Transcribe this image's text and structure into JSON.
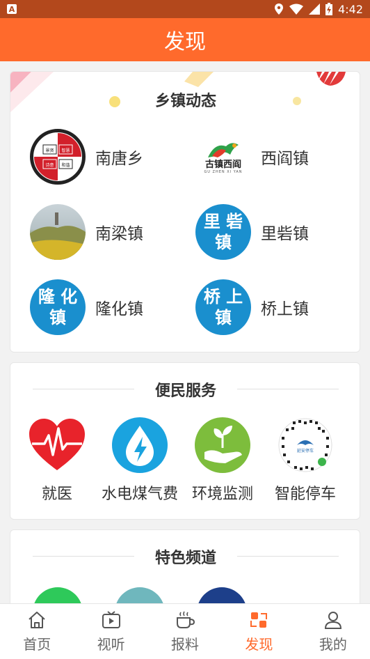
{
  "status_bar": {
    "time": "4:42",
    "notification_icon": "A"
  },
  "header": {
    "title": "发现"
  },
  "towns": {
    "title": "乡镇动态",
    "items": [
      {
        "label": "南唐乡",
        "logo_text": [
          "景贤",
          "智慧",
          "诗意",
          "和谐"
        ]
      },
      {
        "label": "西阎镇",
        "logo_text": "古镇西阎",
        "logo_subtext": "GU ZHEN XI YAN"
      },
      {
        "label": "南梁镇"
      },
      {
        "label": "里砦镇",
        "logo_text": [
          "里 砦",
          "镇"
        ]
      },
      {
        "label": "隆化镇",
        "logo_text": [
          "隆 化",
          "镇"
        ]
      },
      {
        "label": "桥上镇",
        "logo_text": [
          "桥 上",
          "镇"
        ]
      }
    ]
  },
  "services": {
    "title": "便民服务",
    "items": [
      {
        "label": "就医",
        "icon": "heart-pulse-icon",
        "color": "#e8232b"
      },
      {
        "label": "水电煤气费",
        "icon": "water-drop-bolt-icon",
        "color": "#1aa3df"
      },
      {
        "label": "环境监测",
        "icon": "hand-sprout-icon",
        "color": "#7dbd3c"
      },
      {
        "label": "智能停车",
        "icon": "qr-code-icon",
        "qr_caption": "延安停车"
      }
    ]
  },
  "channels": {
    "title": "特色频道"
  },
  "tabbar": {
    "items": [
      {
        "label": "首页",
        "icon": "home-icon"
      },
      {
        "label": "视听",
        "icon": "tv-play-icon"
      },
      {
        "label": "报料",
        "icon": "coffee-cup-icon"
      },
      {
        "label": "发现",
        "icon": "discover-icon",
        "active": true
      },
      {
        "label": "我的",
        "icon": "user-icon"
      }
    ]
  },
  "colors": {
    "accent": "#ff6a2c",
    "status_bar": "#b3481c",
    "blue_logo": "#1a8fce"
  }
}
